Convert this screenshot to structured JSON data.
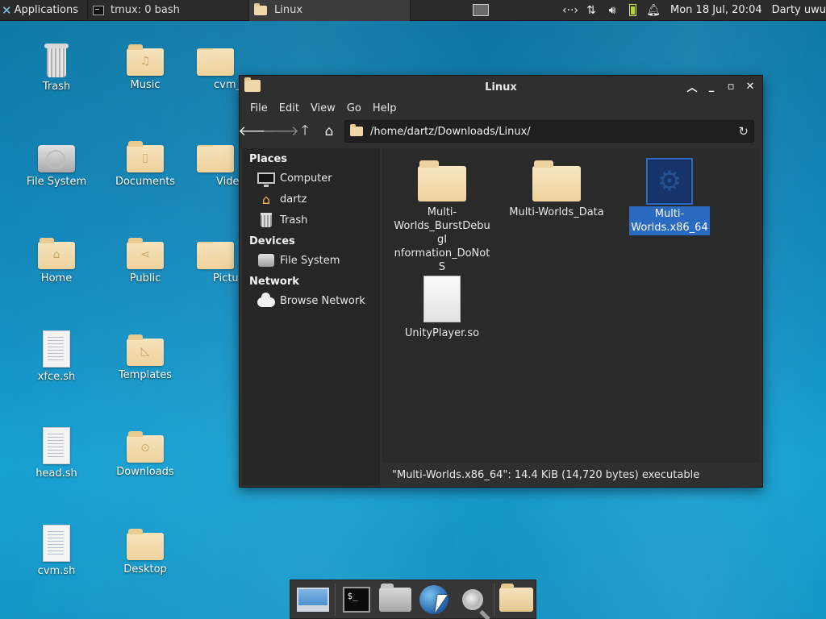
{
  "panel": {
    "applications_label": "Applications",
    "tasks": [
      {
        "label": "tmux: 0 bash"
      },
      {
        "label": "Linux"
      }
    ],
    "clock": "Mon 18 Jul, 20:04",
    "user": "Darty uwu"
  },
  "desktop": {
    "icons": [
      {
        "label": "Trash"
      },
      {
        "label": "Music"
      },
      {
        "label": "cvm_"
      },
      {
        "label": "File System"
      },
      {
        "label": "Documents"
      },
      {
        "label": "Vide"
      },
      {
        "label": "Home"
      },
      {
        "label": "Public"
      },
      {
        "label": "Pictu"
      },
      {
        "label": "xfce.sh"
      },
      {
        "label": "Templates"
      },
      {
        "label": "head.sh"
      },
      {
        "label": "Downloads"
      },
      {
        "label": "cvm.sh"
      },
      {
        "label": "Desktop"
      }
    ]
  },
  "window": {
    "title": "Linux",
    "menu": [
      "File",
      "Edit",
      "View",
      "Go",
      "Help"
    ],
    "address": "/home/dartz/Downloads/Linux/",
    "sidebar": {
      "places_header": "Places",
      "places": [
        "Computer",
        "dartz",
        "Trash"
      ],
      "devices_header": "Devices",
      "devices": [
        "File System"
      ],
      "network_header": "Network",
      "network": [
        "Browse Network"
      ]
    },
    "files": [
      {
        "name": "Multi-Worlds_BurstDebugInformation_DoNotShip",
        "display": "Multi-\nWorlds_BurstDebugI\nnformation_DoNotS\nhip"
      },
      {
        "name": "Multi-Worlds_Data",
        "display": "Multi-Worlds_Data"
      },
      {
        "name": "Multi-Worlds.x86_64",
        "display": "Multi-\nWorlds.x86_64",
        "selected": true
      },
      {
        "name": "UnityPlayer.so",
        "display": "UnityPlayer.so"
      }
    ],
    "status": "\"Multi-Worlds.x86_64\": 14.4 KiB (14,720 bytes) executable"
  },
  "dock": {
    "terminal_prompt": "$_"
  }
}
